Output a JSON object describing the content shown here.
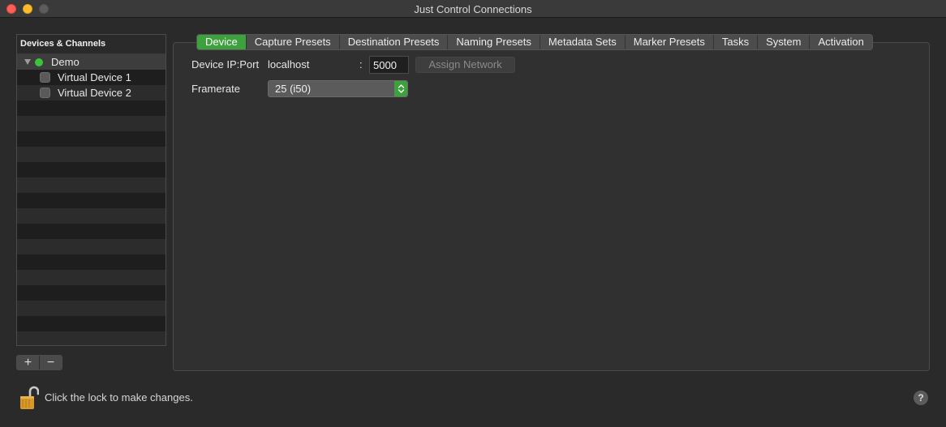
{
  "window": {
    "title": "Just Control Connections"
  },
  "sidebar": {
    "header": "Devices & Channels",
    "items": [
      {
        "label": "Demo",
        "status_color": "#3cc23c"
      },
      {
        "label": "Virtual Device 1"
      },
      {
        "label": "Virtual Device 2"
      }
    ],
    "add_label": "+",
    "remove_label": "−"
  },
  "tabs": [
    {
      "label": "Device",
      "active": true
    },
    {
      "label": "Capture Presets"
    },
    {
      "label": "Destination Presets"
    },
    {
      "label": "Naming Presets"
    },
    {
      "label": "Metadata Sets"
    },
    {
      "label": "Marker Presets"
    },
    {
      "label": "Tasks"
    },
    {
      "label": "System"
    },
    {
      "label": "Activation"
    }
  ],
  "device": {
    "ip_port_label": "Device IP:Port",
    "host": "localhost",
    "separator": ":",
    "port": "5000",
    "assign_label": "Assign Network",
    "framerate_label": "Framerate",
    "framerate_value": "25 (i50)"
  },
  "footer": {
    "lock_text": "Click the lock to make changes.",
    "help_label": "?"
  },
  "colors": {
    "accent": "#3da13d",
    "background": "#2a2a2a"
  }
}
